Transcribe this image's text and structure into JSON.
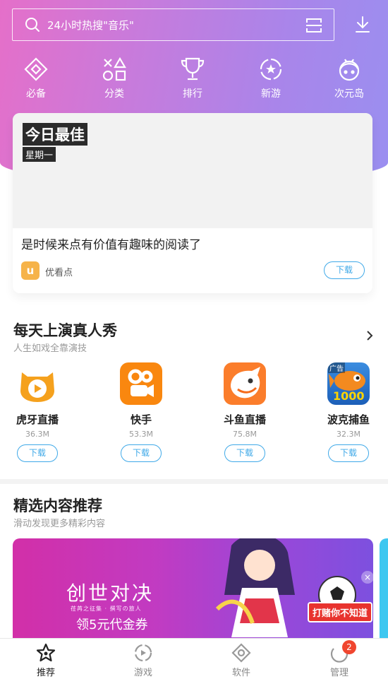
{
  "search": {
    "placeholder": "24小时热搜\"音乐\""
  },
  "nav": [
    {
      "label": "必备",
      "icon": "diamond-icon"
    },
    {
      "label": "分类",
      "icon": "shapes-icon"
    },
    {
      "label": "排行",
      "icon": "trophy-icon"
    },
    {
      "label": "新游",
      "icon": "star-badge-icon"
    },
    {
      "label": "次元岛",
      "icon": "anime-girl-icon"
    }
  ],
  "featured": {
    "tag_title": "今日最佳",
    "tag_day": "星期一",
    "description": "是时候来点有价值有趣味的阅读了",
    "app_logo_letter": "u",
    "app_name": "优看点",
    "download_label": "下载"
  },
  "section1": {
    "title": "每天上演真人秀",
    "subtitle": "人生如戏全靠演技",
    "apps": [
      {
        "name": "虎牙直播",
        "size": "36.3M",
        "download": "下载"
      },
      {
        "name": "快手",
        "size": "53.3M",
        "download": "下载"
      },
      {
        "name": "斗鱼直播",
        "size": "75.8M",
        "download": "下载"
      },
      {
        "name": "波克捕鱼",
        "size": "32.3M",
        "download": "下载",
        "ad_label": "广告",
        "icon_text": "1000"
      }
    ]
  },
  "section2": {
    "title": "精选内容推荐",
    "subtitle": "滑动发现更多精彩内容",
    "banner": {
      "title": "创世对决",
      "small_text": "荏苒之征集 · 撰写の旅人",
      "subtitle": "领5元代金券",
      "badge": "打赌你不知道",
      "close": "×"
    }
  },
  "tabs": [
    {
      "label": "推荐",
      "active": true
    },
    {
      "label": "游戏"
    },
    {
      "label": "软件"
    },
    {
      "label": "管理",
      "badge": "2"
    }
  ],
  "colors": {
    "accent": "#3fa9e8",
    "header_start": "#e56fc9",
    "header_end": "#9a8ff0",
    "badge": "#f0462f"
  }
}
